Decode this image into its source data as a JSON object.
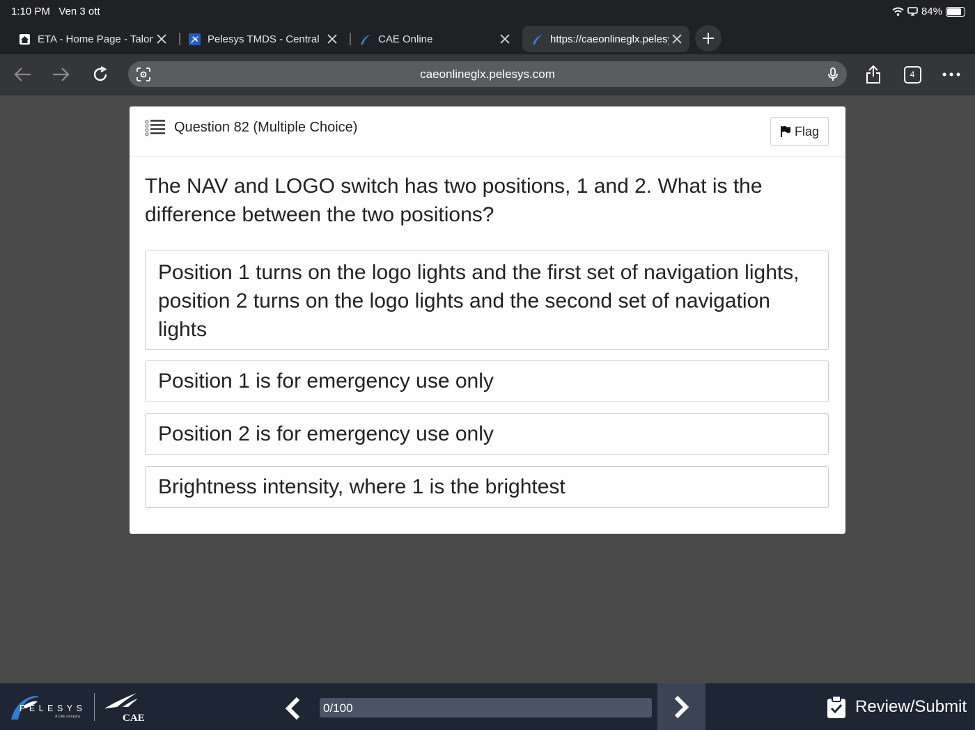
{
  "status": {
    "time": "1:10 PM",
    "date": "Ven 3 ott",
    "battery": "84%",
    "battery_level": 0.84
  },
  "tabs": [
    {
      "title": "ETA - Home Page - Talon",
      "active": false
    },
    {
      "title": "Pelesys TMDS - Central",
      "active": false
    },
    {
      "title": "CAE Online",
      "active": false
    },
    {
      "title": "https://caeonlineglx.pelesys.com",
      "active": true
    }
  ],
  "toolbar": {
    "url": "caeonlineglx.pelesys.com",
    "tab_count": "4"
  },
  "question": {
    "title": "Question 82 (Multiple Choice)",
    "flag_label": "Flag",
    "text": "The NAV and LOGO switch has two positions, 1 and 2. What is the difference between the two positions?",
    "options": [
      "Position 1 turns on the logo lights and the first set of navigation lights, position 2 turns on the logo lights and the second set of navigation lights",
      "Position 1 is for emergency use only",
      "Position 2 is for emergency use only",
      "Brightness intensity, where 1 is the brightest"
    ]
  },
  "footer": {
    "brand": "PELESYS",
    "brand_tag": "A CAE company",
    "partner": "CAE",
    "progress_text": "0/100",
    "progress_fraction": 0,
    "review_label": "Review/Submit"
  },
  "colors": {
    "background": "#4a4a4a",
    "footer": "#1e2633",
    "accent": "#1a5aa8"
  }
}
